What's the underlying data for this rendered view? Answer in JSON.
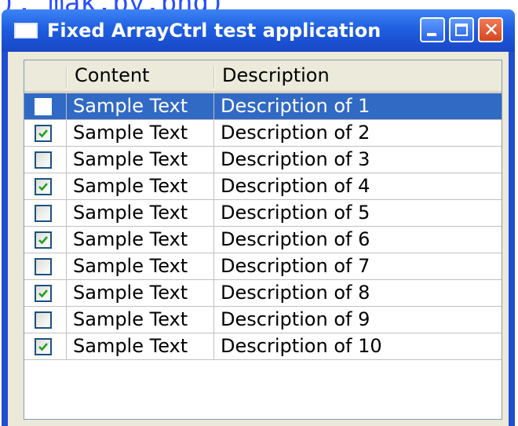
{
  "background_link": "), mak.py.png)",
  "window": {
    "title": "Fixed ArrayCtrl test application",
    "icons": {
      "app": "app-window-icon",
      "min": "minimize-icon",
      "max": "maximize-icon",
      "close": "close-icon"
    },
    "close_glyph": "✕"
  },
  "list": {
    "columns": [
      "",
      "Content",
      "Description"
    ],
    "rows": [
      {
        "checked": false,
        "selected": true,
        "content": "Sample Text",
        "description": "Description of 1"
      },
      {
        "checked": true,
        "selected": false,
        "content": "Sample Text",
        "description": "Description of 2"
      },
      {
        "checked": false,
        "selected": false,
        "content": "Sample Text",
        "description": "Description of 3"
      },
      {
        "checked": true,
        "selected": false,
        "content": "Sample Text",
        "description": "Description of 4"
      },
      {
        "checked": false,
        "selected": false,
        "content": "Sample Text",
        "description": "Description of 5"
      },
      {
        "checked": true,
        "selected": false,
        "content": "Sample Text",
        "description": "Description of 6"
      },
      {
        "checked": false,
        "selected": false,
        "content": "Sample Text",
        "description": "Description of 7"
      },
      {
        "checked": true,
        "selected": false,
        "content": "Sample Text",
        "description": "Description of 8"
      },
      {
        "checked": false,
        "selected": false,
        "content": "Sample Text",
        "description": "Description of 9"
      },
      {
        "checked": true,
        "selected": false,
        "content": "Sample Text",
        "description": "Description of 10"
      }
    ]
  },
  "colors": {
    "titlebar": "#1f5fe0",
    "selection": "#316ac5",
    "check": "#21a121",
    "header_bg": "#ebeadb",
    "client_bg": "#ece9d8"
  }
}
